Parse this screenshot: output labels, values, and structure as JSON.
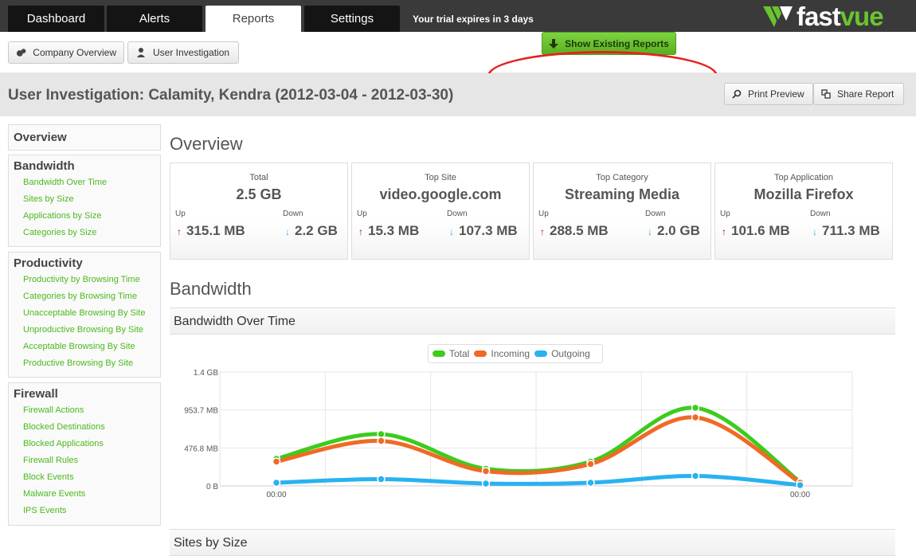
{
  "nav": {
    "tabs": [
      {
        "label": "Dashboard",
        "active": false
      },
      {
        "label": "Alerts",
        "active": false
      },
      {
        "label": "Reports",
        "active": true
      },
      {
        "label": "Settings",
        "active": false
      }
    ],
    "trial_text": "Your trial expires in 3 days",
    "logo_fast": "fast",
    "logo_vue": "vue"
  },
  "toolbar": {
    "company_overview": "Company Overview",
    "user_investigation": "User Investigation",
    "show_existing": "Show Existing Reports",
    "print_preview": "Print Preview",
    "share_report": "Share Report"
  },
  "page_title": "User Investigation: Calamity, Kendra (2012-03-04 - 2012-03-30)",
  "sidebar": {
    "overview": "Overview",
    "groups": [
      {
        "title": "Bandwidth",
        "items": [
          "Bandwidth Over Time",
          "Sites by Size",
          "Applications by Size",
          "Categories by Size"
        ]
      },
      {
        "title": "Productivity",
        "items": [
          "Productivity by Browsing Time",
          "Categories by Browsing Time",
          "Unacceptable Browsing By Site",
          "Unproductive Browsing By Site",
          "Acceptable Browsing By Site",
          "Productive Browsing By Site"
        ]
      },
      {
        "title": "Firewall",
        "items": [
          "Firewall Actions",
          "Blocked Destinations",
          "Blocked Applications",
          "Firewall Rules",
          "Block Events",
          "Malware Events",
          "IPS Events"
        ]
      }
    ]
  },
  "overview": {
    "heading": "Overview",
    "up_label": "Up",
    "down_label": "Down",
    "cards": [
      {
        "label": "Total",
        "value": "2.5 GB",
        "up": "315.1 MB",
        "down": "2.2 GB"
      },
      {
        "label": "Top Site",
        "value": "video.google.com",
        "up": "15.3 MB",
        "down": "107.3 MB"
      },
      {
        "label": "Top Category",
        "value": "Streaming Media",
        "up": "288.5 MB",
        "down": "2.0 GB"
      },
      {
        "label": "Top Application",
        "value": "Mozilla Firefox",
        "up": "101.6 MB",
        "down": "711.3 MB"
      }
    ]
  },
  "bandwidth": {
    "heading": "Bandwidth",
    "section_title": "Bandwidth Over Time",
    "next_section_title": "Sites by Size"
  },
  "colors": {
    "total": "#3ccc1c",
    "incoming": "#f06a25",
    "outgoing": "#28b2f0",
    "accent": "#6ac42f",
    "link": "#4cb81e"
  },
  "chart_data": {
    "type": "line",
    "legend": [
      "Total",
      "Incoming",
      "Outgoing"
    ],
    "legend_position": "top-center",
    "y_ticks": [
      "0 B",
      "476.8 MB",
      "953.7 MB",
      "1.4 GB"
    ],
    "x_ticks": [
      "00:00",
      "00:00"
    ],
    "y_range_mb": [
      0,
      1430.5
    ],
    "grid": true,
    "x": [
      0,
      1,
      2,
      3,
      4,
      5
    ],
    "series": [
      {
        "name": "Total",
        "values_mb": [
          340,
          650,
          215,
          305,
          980,
          50
        ]
      },
      {
        "name": "Incoming",
        "values_mb": [
          305,
          565,
          185,
          275,
          860,
          40
        ]
      },
      {
        "name": "Outgoing",
        "values_mb": [
          40,
          85,
          30,
          40,
          125,
          10
        ]
      }
    ]
  }
}
